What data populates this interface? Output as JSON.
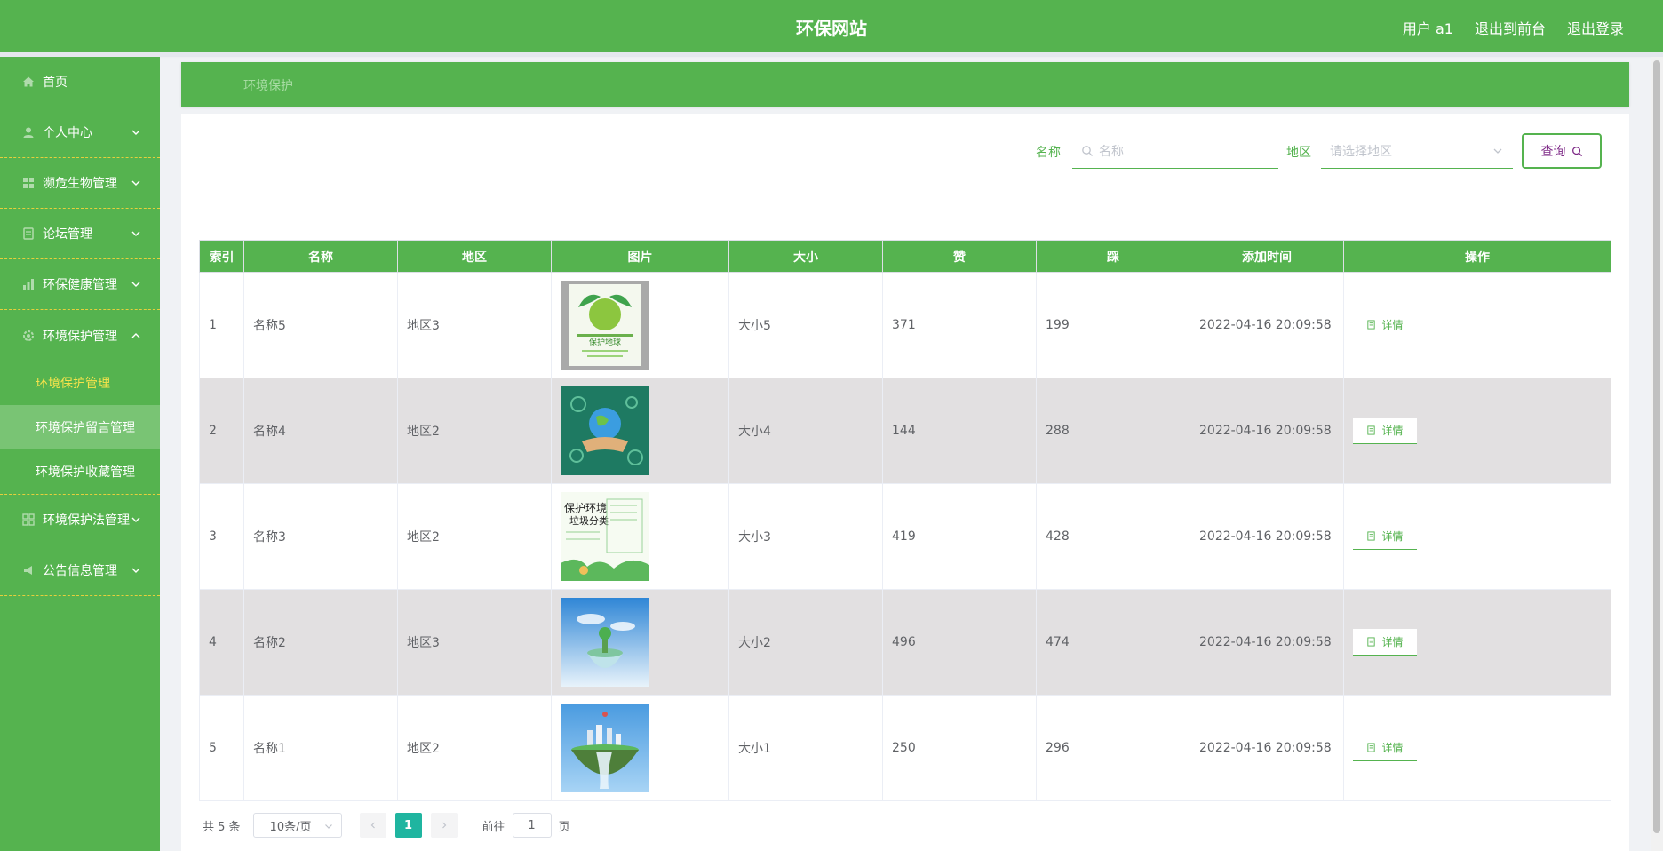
{
  "header": {
    "title": "环保网站",
    "user": "用户 a1",
    "to_front": "退出到前台",
    "logout": "退出登录"
  },
  "sidebar": {
    "items": [
      {
        "label": "首页",
        "icon": "home-icon"
      },
      {
        "label": "个人中心",
        "icon": "user-icon"
      },
      {
        "label": "濒危生物管理",
        "icon": "grid-icon"
      },
      {
        "label": "论坛管理",
        "icon": "forum-icon"
      },
      {
        "label": "环保健康管理",
        "icon": "chart-icon"
      },
      {
        "label": "环境保护管理",
        "icon": "gear-icon"
      },
      {
        "label": "环境保护法管理",
        "icon": "apps-icon"
      },
      {
        "label": "公告信息管理",
        "icon": "notice-icon"
      }
    ],
    "sub_items": [
      "环境保护管理",
      "环境保护留言管理",
      "环境保护收藏管理"
    ]
  },
  "breadcrumb": "环境保护",
  "search": {
    "name_label": "名称",
    "name_placeholder": "名称",
    "region_label": "地区",
    "region_placeholder": "请选择地区",
    "button": "查询"
  },
  "table": {
    "columns": [
      "索引",
      "名称",
      "地区",
      "图片",
      "大小",
      "赞",
      "踩",
      "添加时间",
      "操作"
    ],
    "rows": [
      {
        "index": "1",
        "name": "名称5",
        "region": "地区3",
        "size": "大小5",
        "likes": "371",
        "dislikes": "199",
        "time": "2022-04-16 20:09:58",
        "action": "详情"
      },
      {
        "index": "2",
        "name": "名称4",
        "region": "地区2",
        "size": "大小4",
        "likes": "144",
        "dislikes": "288",
        "time": "2022-04-16 20:09:58",
        "action": "详情"
      },
      {
        "index": "3",
        "name": "名称3",
        "region": "地区2",
        "size": "大小3",
        "likes": "419",
        "dislikes": "428",
        "time": "2022-04-16 20:09:58",
        "action": "详情"
      },
      {
        "index": "4",
        "name": "名称2",
        "region": "地区3",
        "size": "大小2",
        "likes": "496",
        "dislikes": "474",
        "time": "2022-04-16 20:09:58",
        "action": "详情"
      },
      {
        "index": "5",
        "name": "名称1",
        "region": "地区2",
        "size": "大小1",
        "likes": "250",
        "dislikes": "296",
        "time": "2022-04-16 20:09:58",
        "action": "详情"
      }
    ]
  },
  "thumb_text": {
    "row1": "保护地球",
    "row3_line1": "保护环境",
    "row3_line2": "垃圾分类"
  },
  "pagination": {
    "total": "共 5 条",
    "page_size": "10条/页",
    "current": "1",
    "goto_label": "前往",
    "goto_value": "1",
    "page_suffix": "页"
  },
  "colors": {
    "brand": "#55b34f",
    "active_sub": "#f7e34b",
    "page_active": "#1fb5a0"
  }
}
